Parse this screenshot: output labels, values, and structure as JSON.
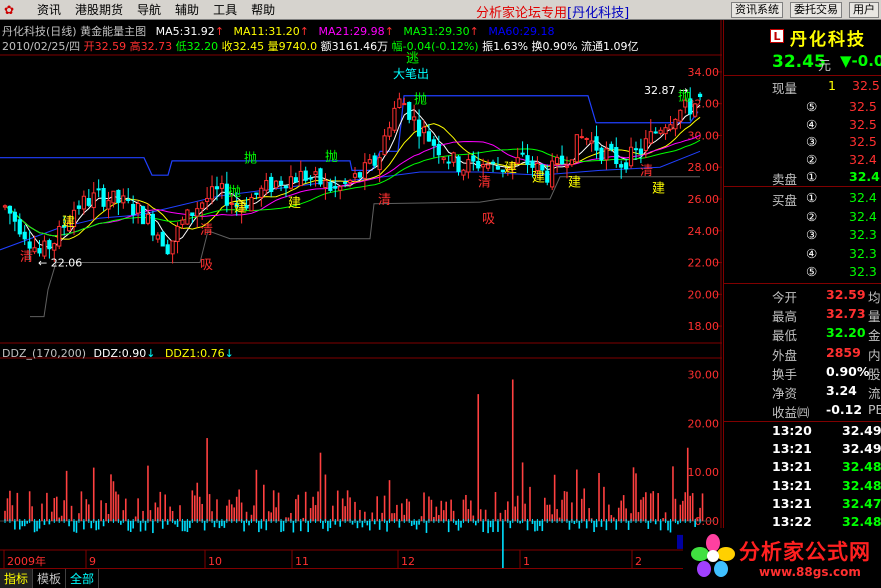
{
  "menu": {
    "items": [
      "资讯",
      "港股期货",
      "导航",
      "辅助",
      "工具",
      "帮助"
    ],
    "center_title_main": "分析家论坛专用",
    "center_title_stock": "[丹化科技]",
    "right_buttons": [
      "资讯系统",
      "委托交易",
      "用户"
    ]
  },
  "chart_header": {
    "line1_title": "丹化科技(日线) 黄金能量主图",
    "ma5": "MA5:31.92",
    "ma11": "MA11:31.20",
    "ma21": "MA21:29.98",
    "ma31": "MA31:29.30",
    "ma60": "MA60:29.18",
    "ma_extra": "搞波:22.92",
    "ma_extra2": "高点:27.67",
    "date": "2010/02/25/四",
    "open": "开32.59",
    "high": "高32.73",
    "low": "低32.20",
    "close": "收32.45",
    "volume": "量9740.0",
    "amount": "额3161.46万",
    "change": "幅-0.04(-0.12%)",
    "amplitude": "振1.63%",
    "turnover": "换0.90%",
    "float": "流通1.09亿"
  },
  "price_axis": [
    "34.00",
    "32.00",
    "30.00",
    "28.00",
    "26.00",
    "24.00",
    "22.00",
    "20.00",
    "18.00"
  ],
  "ddz_header": {
    "name": "DDZ_(170,200)",
    "ddz": "DDZ:0.90",
    "ddz1": "DDZ1:0.76"
  },
  "ddz_axis": [
    "30.00",
    "20.00",
    "10.00",
    "0.00"
  ],
  "ddz_current": "-4.29",
  "time_axis": [
    "2009年",
    "9",
    "10",
    "11",
    "12",
    "1",
    "2"
  ],
  "annotations": {
    "price_low": "22.06",
    "price_high": "32.87",
    "top_label": "大笔出",
    "signals": [
      "清",
      "吸",
      "建",
      "抛",
      "逃",
      "建",
      "清",
      "抛",
      "建",
      "吸",
      "建",
      "抛",
      "建",
      "清",
      "建",
      "清",
      "建",
      "建",
      "建",
      "逃",
      "抛"
    ]
  },
  "side_panel": {
    "stock_badge": "L",
    "stock_name": "丹化科技",
    "price": "32.45",
    "price_unit": "元",
    "change": "▼-0.0",
    "current_vol_label": "现量",
    "current_vol": "1",
    "current_vol_val": "32.5",
    "sell_label": "卖盘",
    "buy_label": "买盘",
    "sell": [
      {
        "n": "⑤",
        "p": "32.5"
      },
      {
        "n": "④",
        "p": "32.5"
      },
      {
        "n": "③",
        "p": "32.5"
      },
      {
        "n": "②",
        "p": "32.4"
      },
      {
        "n": "①",
        "p": "32.4"
      }
    ],
    "buy": [
      {
        "n": "①",
        "p": "32.4"
      },
      {
        "n": "②",
        "p": "32.4"
      },
      {
        "n": "③",
        "p": "32.3"
      },
      {
        "n": "④",
        "p": "32.3"
      },
      {
        "n": "⑤",
        "p": "32.3"
      }
    ],
    "stats": [
      {
        "label": "今开",
        "value": "32.59",
        "tail": "均"
      },
      {
        "label": "最高",
        "value": "32.73",
        "tail": "量"
      },
      {
        "label": "最低",
        "value": "32.20",
        "tail": "金"
      },
      {
        "label": "外盘",
        "value": "2859",
        "tail": "内"
      },
      {
        "label": "换手",
        "value": "0.90%",
        "tail": "股"
      },
      {
        "label": "净资",
        "value": "3.24",
        "tail": "流"
      },
      {
        "label": "收益㈣",
        "value": "-0.12",
        "tail": "PE"
      }
    ],
    "ticks": [
      {
        "t": "13:20",
        "p": "32.49"
      },
      {
        "t": "13:21",
        "p": "32.49"
      },
      {
        "t": "13:21",
        "p": "32.48"
      },
      {
        "t": "13:21",
        "p": "32.48"
      },
      {
        "t": "13:21",
        "p": "32.47"
      },
      {
        "t": "13:22",
        "p": "32.48"
      }
    ]
  },
  "bottom_tabs": [
    "指标",
    "模板",
    "全部"
  ],
  "brand": {
    "name": "分析家公式网",
    "url": "www.88gs.com"
  },
  "colors": {
    "up": "#ff3030",
    "down": "#00ffff",
    "ma5": "#ffffff",
    "ma11": "#ffff00",
    "ma21": "#ff00ff",
    "ma31": "#00ff00",
    "ma60": "#0000ff"
  }
}
